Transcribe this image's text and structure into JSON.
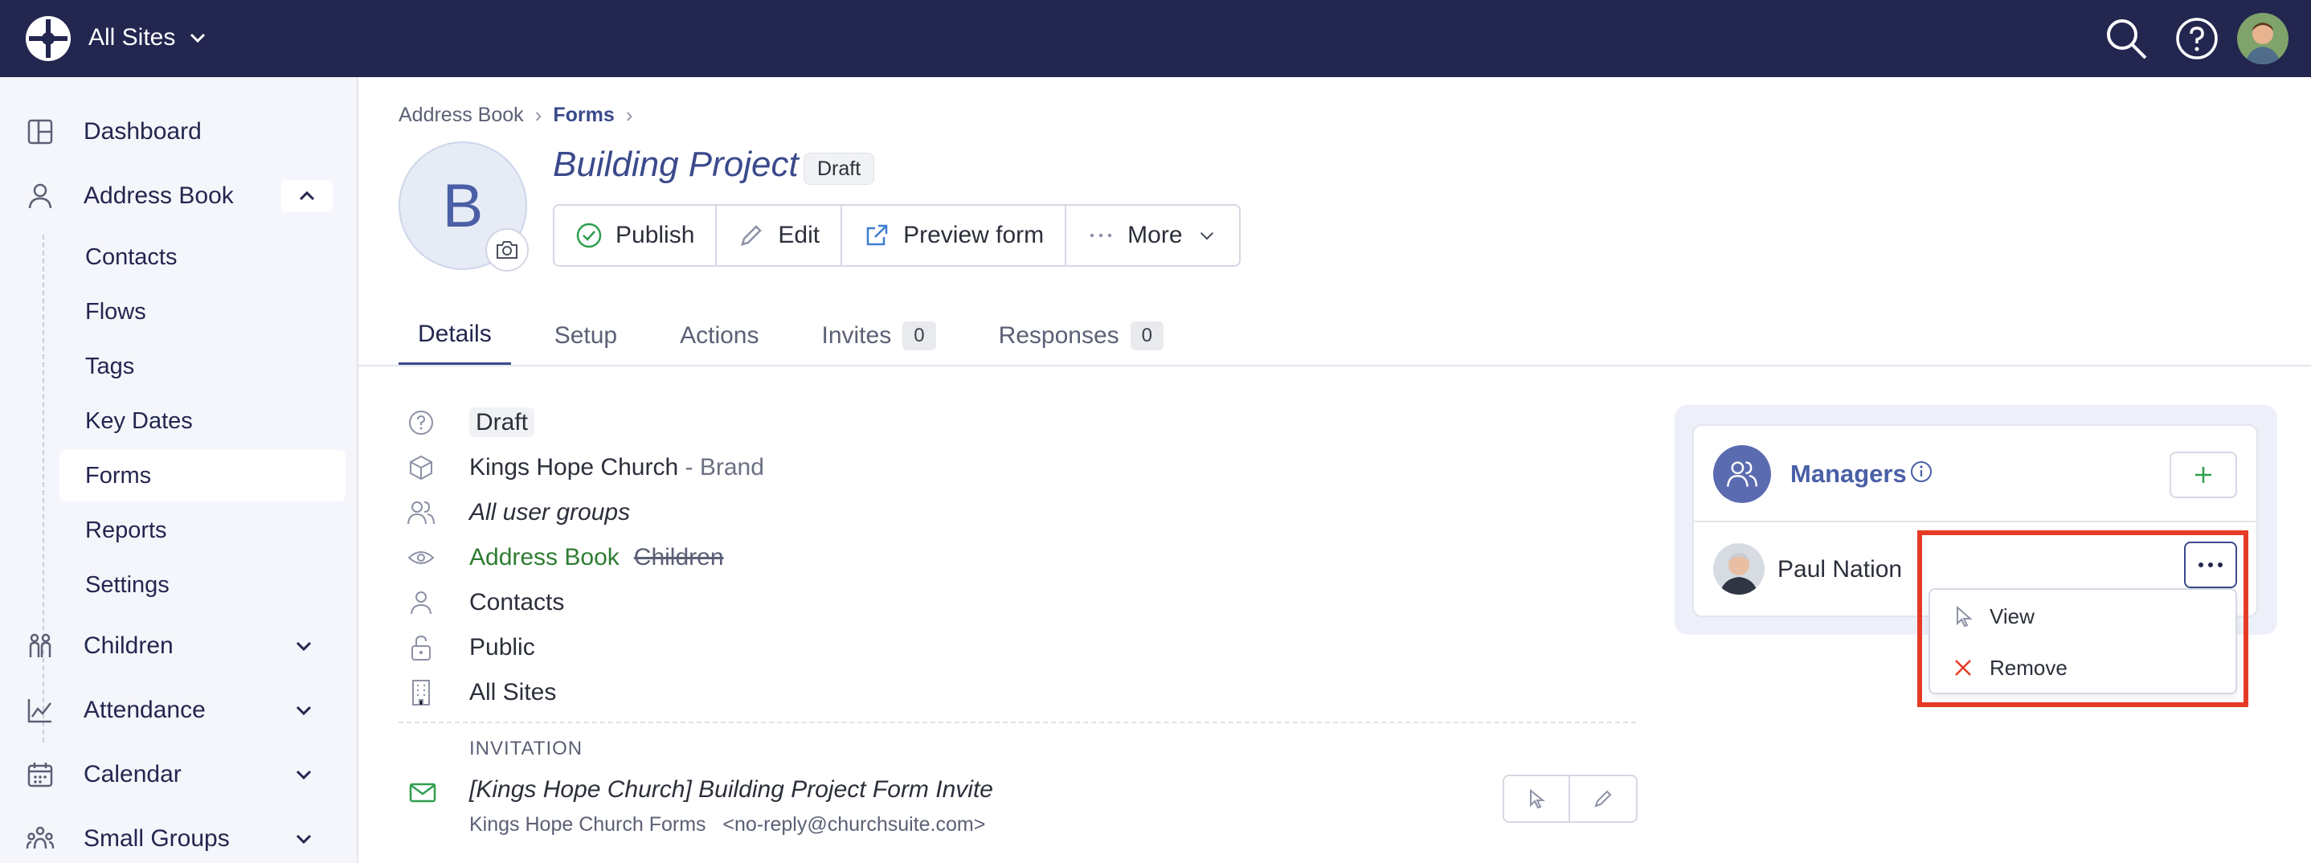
{
  "topbar": {
    "site_selector": "All Sites"
  },
  "sidebar": {
    "items": [
      {
        "label": "Dashboard"
      },
      {
        "label": "Address Book"
      },
      {
        "label": "Children"
      },
      {
        "label": "Attendance"
      },
      {
        "label": "Calendar"
      },
      {
        "label": "Small Groups"
      }
    ],
    "subitems": [
      "Contacts",
      "Flows",
      "Tags",
      "Key Dates",
      "Forms",
      "Reports",
      "Settings"
    ],
    "active_subitem": "Forms"
  },
  "breadcrumb": {
    "root": "Address Book",
    "current": "Forms"
  },
  "form": {
    "avatar_letter": "B",
    "title": "Building Project",
    "status_badge": "Draft"
  },
  "actions": {
    "publish": "Publish",
    "edit": "Edit",
    "preview": "Preview form",
    "more": "More"
  },
  "tabs": [
    {
      "label": "Details"
    },
    {
      "label": "Setup"
    },
    {
      "label": "Actions"
    },
    {
      "label": "Invites",
      "count": "0"
    },
    {
      "label": "Responses",
      "count": "0"
    }
  ],
  "details": {
    "status": "Draft",
    "brand_name": "Kings Hope Church",
    "brand_suffix": "- Brand",
    "user_groups": "All user groups",
    "visibility_active": "Address Book",
    "visibility_inactive": "Children",
    "module": "Contacts",
    "access": "Public",
    "sites": "All Sites"
  },
  "invitation": {
    "heading": "INVITATION",
    "subject": "[Kings Hope Church] Building Project Form Invite",
    "from_name": "Kings Hope Church Forms",
    "from_email": "<no-reply@churchsuite.com>"
  },
  "managers": {
    "title": "Managers",
    "people": [
      {
        "name": "Paul Nation"
      }
    ],
    "menu": {
      "view": "View",
      "remove": "Remove"
    }
  },
  "colors": {
    "topbar": "#23264f",
    "accent": "#3b4a8c",
    "highlight": "#e53b26",
    "publish_icon": "#2e9e4f",
    "remove_icon": "#e53b26"
  }
}
